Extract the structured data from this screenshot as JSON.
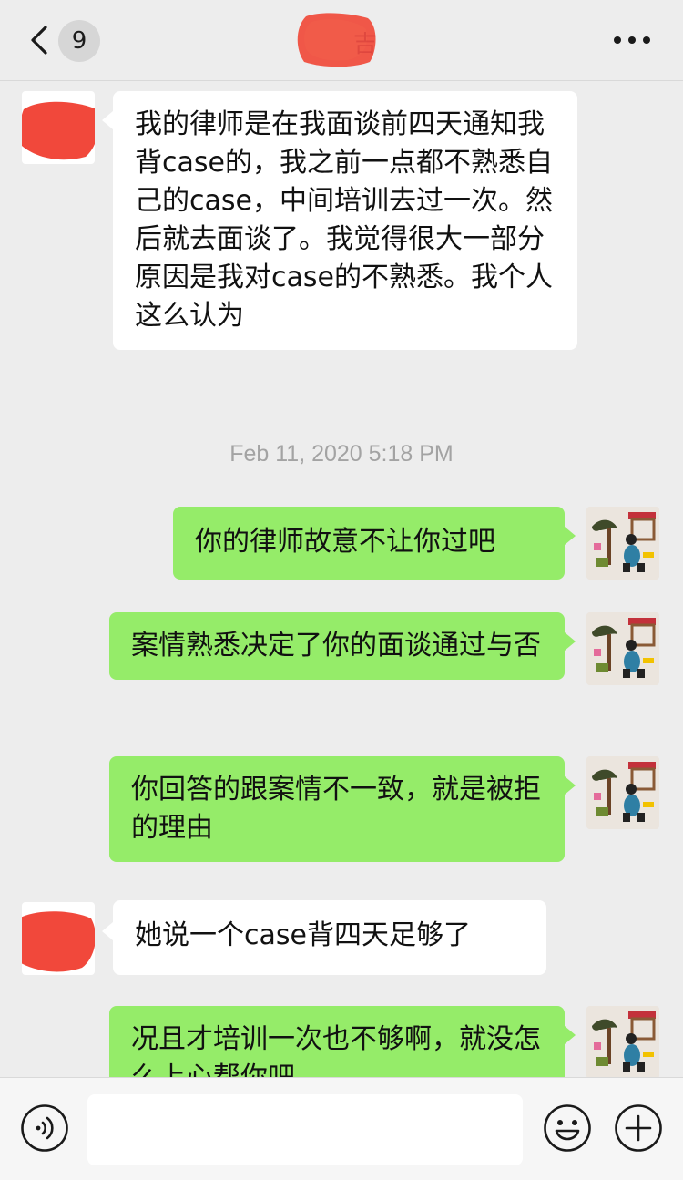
{
  "header": {
    "unread_count": "9",
    "title": "吉"
  },
  "messages": [
    {
      "side": "peer",
      "text": "我的律师是在我面谈前四天通知我背case的，我之前一点都不熟悉自己的case，中间培训去过一次。然后就去面谈了。我觉得很大一部分原因是我对case的不熟悉。我个人这么认为"
    },
    {
      "side": "self",
      "text": "你的律师故意不让你过吧"
    },
    {
      "side": "self",
      "text": "案情熟悉决定了你的面谈通过与否"
    },
    {
      "side": "self",
      "text": "你回答的跟案情不一致，就是被拒的理由"
    },
    {
      "side": "peer",
      "text": "她说一个case背四天足够了"
    },
    {
      "side": "self",
      "text": "况且才培训一次也不够啊，就没怎么上心帮你吧"
    }
  ],
  "timestamp": "Feb 11, 2020 5:18 PM",
  "composer": {
    "input_value": ""
  },
  "colors": {
    "self_bubble": "#95ec69",
    "peer_bubble": "#ffffff",
    "background": "#ededed"
  },
  "icons": {
    "back": "chevron-left-icon",
    "more": "ellipsis-icon",
    "voice": "voice-icon",
    "emoji": "emoji-icon",
    "plus": "plus-icon"
  }
}
